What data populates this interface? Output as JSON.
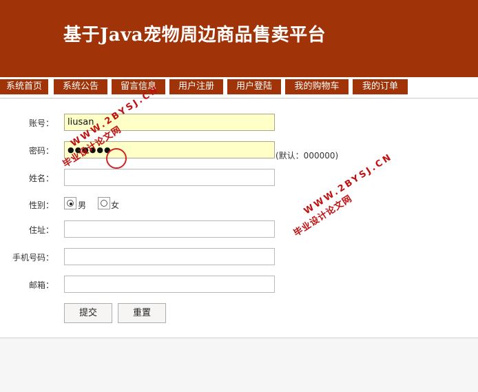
{
  "header": {
    "title": "基于Java宠物周边商品售卖平台"
  },
  "nav": {
    "items": [
      {
        "label": "系统首页"
      },
      {
        "label": "系统公告"
      },
      {
        "label": "留言信息"
      },
      {
        "label": "用户注册"
      },
      {
        "label": "用户登陆"
      },
      {
        "label": "我的购物车"
      },
      {
        "label": "我的订单"
      }
    ]
  },
  "form": {
    "account": {
      "label": "账号：",
      "value": "liusan"
    },
    "password": {
      "label": "密码：",
      "value": "●●●●●●",
      "hint": "(默认：000000)"
    },
    "name": {
      "label": "姓名：",
      "value": ""
    },
    "gender": {
      "label": "性别：",
      "option_male": "男",
      "option_female": "女",
      "selected": "男"
    },
    "address": {
      "label": "住址：",
      "value": ""
    },
    "phone": {
      "label": "手机号码：",
      "value": ""
    },
    "email": {
      "label": "邮箱：",
      "value": ""
    },
    "submit_label": "提交",
    "reset_label": "重置"
  },
  "watermarks": [
    {
      "url": "WWW.2BYSJ.CN",
      "text": "毕业设计论文网"
    },
    {
      "url": "WWW.2BYSJ.CN",
      "text": "毕业设计论文网"
    }
  ],
  "colors": {
    "header_bg": "#a03408",
    "nav_bg": "#a03408",
    "filled_input_bg": "#ffffc8",
    "watermark": "#c01010"
  }
}
